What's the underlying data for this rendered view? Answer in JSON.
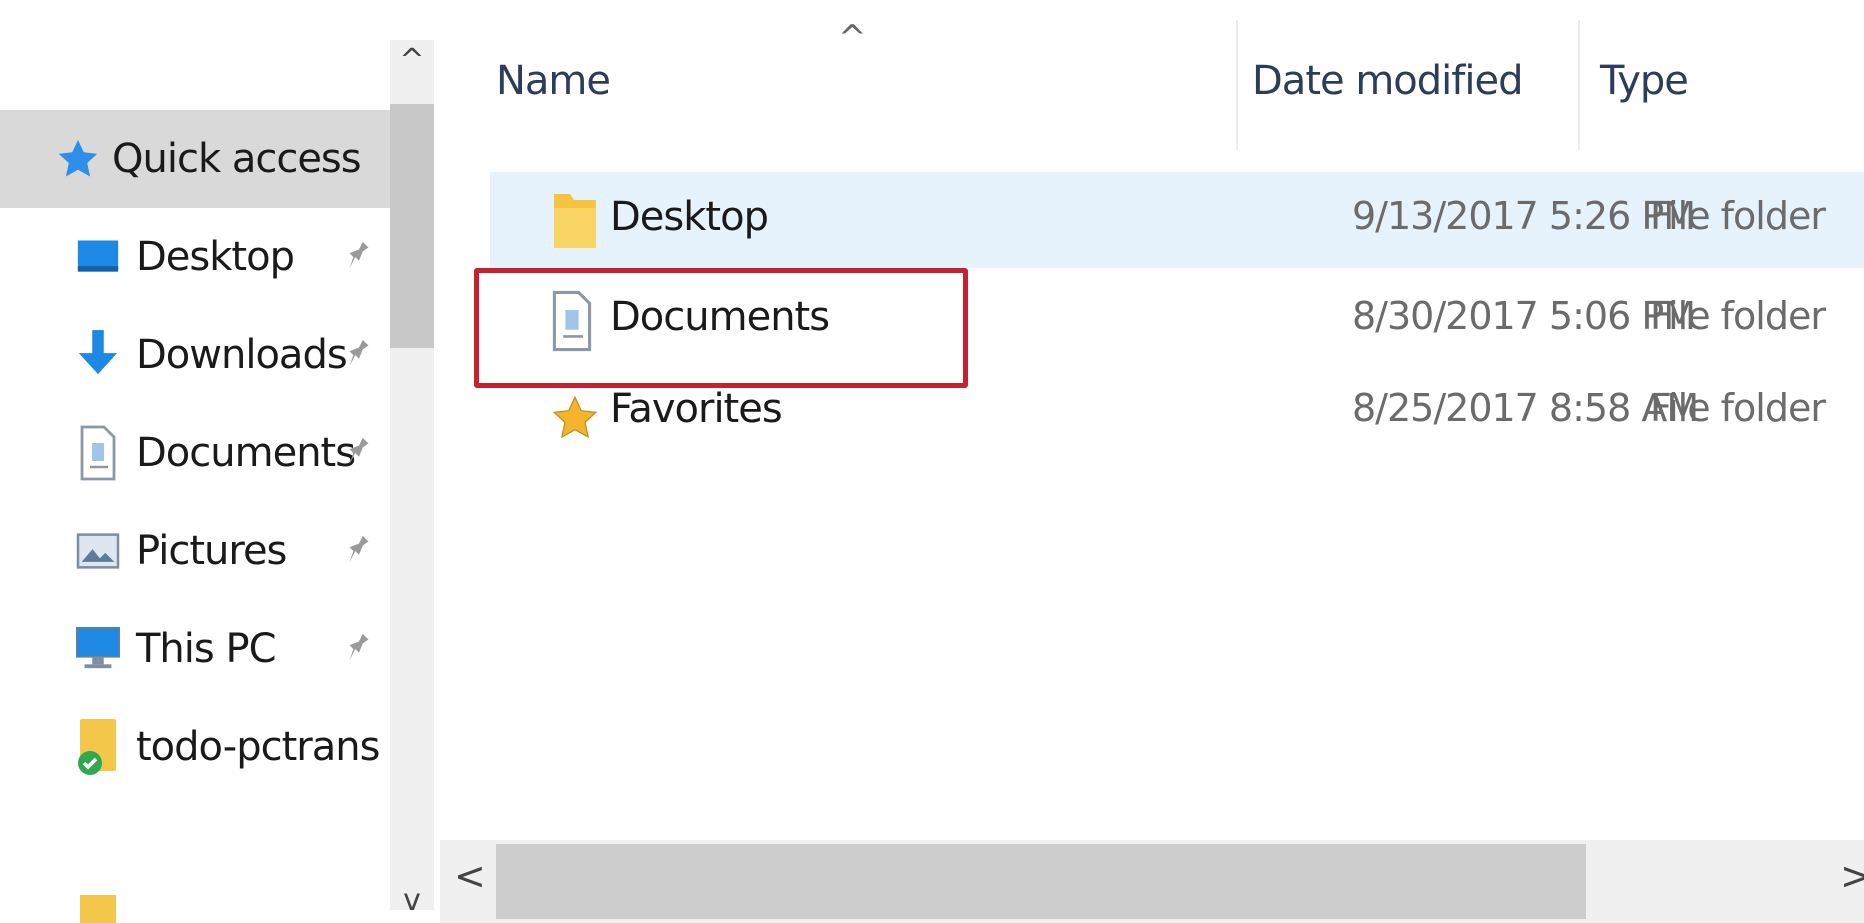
{
  "nav": {
    "scroll_up": "^",
    "scroll_down": "v",
    "items": [
      {
        "label": "Quick access",
        "icon": "star-icon"
      },
      {
        "label": "Desktop",
        "icon": "desktop-icon",
        "pinned": true
      },
      {
        "label": "Downloads",
        "icon": "download-icon",
        "pinned": true
      },
      {
        "label": "Documents",
        "icon": "documents-icon",
        "pinned": true
      },
      {
        "label": "Pictures",
        "icon": "pictures-icon",
        "pinned": true
      },
      {
        "label": "This PC",
        "icon": "computer-icon",
        "pinned": true
      },
      {
        "label": "todo-pctrans",
        "icon": "synced-folder-icon"
      }
    ]
  },
  "content": {
    "sort_indicator": "^",
    "columns": {
      "name": "Name",
      "date": "Date modified",
      "type": "Type"
    },
    "rows": [
      {
        "name": "Desktop",
        "date": "9/13/2017 5:26 PM",
        "type": "File folder",
        "icon": "folder-icon"
      },
      {
        "name": "Documents",
        "date": "8/30/2017 5:06 PM",
        "type": "File folder",
        "icon": "documents-icon"
      },
      {
        "name": "Favorites",
        "date": "8/25/2017 8:58 AM",
        "type": "File folder",
        "icon": "star-icon"
      }
    ],
    "scroll_left": "<",
    "scroll_right": ">"
  },
  "colors": {
    "selection": "#d9d9d9",
    "hover": "#e6f2fc",
    "highlight": "#c8202f",
    "accent": "#1e88e5"
  }
}
